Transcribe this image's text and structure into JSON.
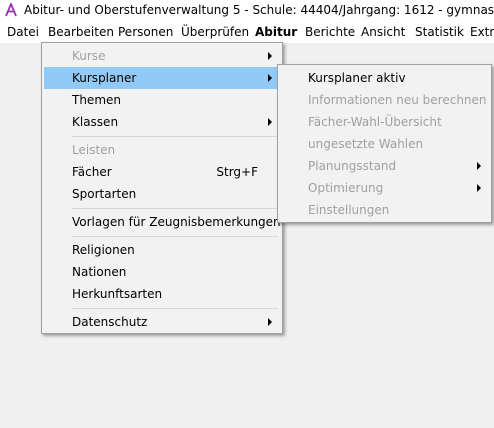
{
  "window": {
    "title": "Abitur- und Oberstufenverwaltung 5 - Schule: 44404/Jahrgang: 1612 - gymnasiale Oberstufe"
  },
  "menubar": [
    {
      "label": "Datei"
    },
    {
      "label": "Bearbeiten"
    },
    {
      "label": "Personen"
    },
    {
      "label": "Überprüfen"
    },
    {
      "label": "Abitur"
    },
    {
      "label": "Berichte"
    },
    {
      "label": "Ansicht"
    },
    {
      "label": "Statistik"
    },
    {
      "label": "Extra"
    }
  ],
  "abitur_menu": {
    "items": [
      {
        "label": "Kurse",
        "disabled": true,
        "submenu": true
      },
      {
        "label": "Kursplaner",
        "highlighted": true,
        "submenu": true
      },
      {
        "label": "Themen"
      },
      {
        "label": "Klassen",
        "submenu": true
      },
      {
        "label": "Leisten",
        "disabled": true
      },
      {
        "label": "Fächer",
        "shortcut": "Strg+F"
      },
      {
        "label": "Sportarten"
      },
      {
        "label": "Vorlagen für Zeugnisbemerkungen"
      },
      {
        "label": "Religionen"
      },
      {
        "label": "Nationen"
      },
      {
        "label": "Herkunftsarten"
      },
      {
        "label": "Datenschutz",
        "submenu": true
      }
    ]
  },
  "kursplaner_submenu": {
    "items": [
      {
        "label": "Kursplaner aktiv"
      },
      {
        "label": "Informationen neu berechnen",
        "disabled": true
      },
      {
        "label": "Fächer-Wahl-Übersicht",
        "disabled": true
      },
      {
        "label": "ungesetzte Wahlen",
        "disabled": true
      },
      {
        "label": "Planungsstand",
        "disabled": true,
        "submenu": true
      },
      {
        "label": "Optimierung",
        "disabled": true,
        "submenu": true
      },
      {
        "label": "Einstellungen",
        "disabled": true
      }
    ]
  },
  "colors": {
    "highlight": "#91c9f7",
    "disabled_text": "#a0a0a0",
    "app_icon": "#9b2fae"
  }
}
